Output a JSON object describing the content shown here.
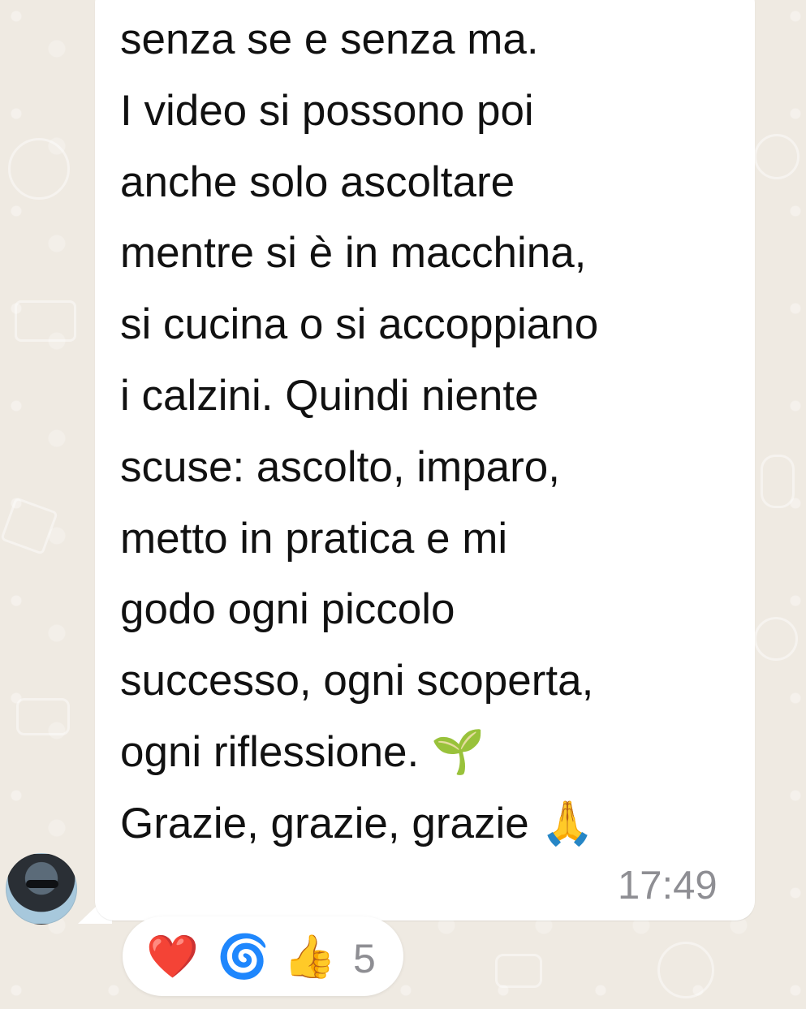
{
  "message": {
    "text": "senza se e senza ma.\nI video si possono poi\nanche solo  ascoltare\nmentre si è in macchina,\nsi cucina o si accoppiano\ni calzini.  Quindi niente\nscuse: ascolto, imparo,\nmetto in pratica e mi\ngodo ogni piccolo\nsuccesso, ogni scoperta,\nogni riflessione. 🌱\nGrazie, grazie, grazie 🙏",
    "time": "17:49"
  },
  "reactions": {
    "heart": "❤️",
    "spiral": "🌀",
    "thumbs_up": "👍",
    "count": "5"
  },
  "colors": {
    "chat_background": "#efeae2",
    "bubble": "#ffffff",
    "timestamp": "#8e8e93"
  }
}
